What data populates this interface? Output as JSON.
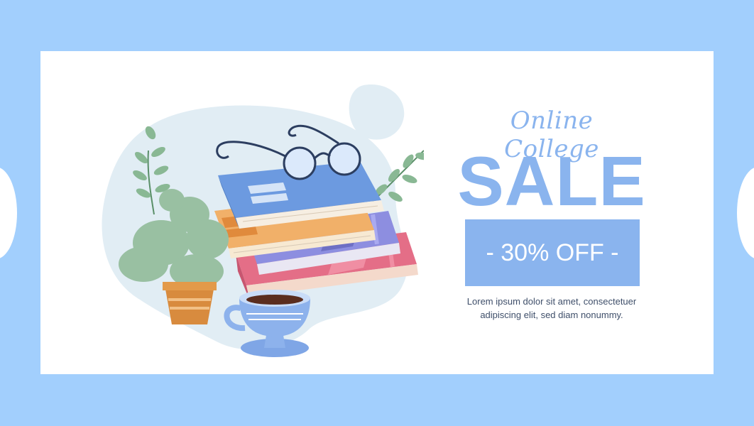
{
  "promo": {
    "script_title": "Online College",
    "headline": "SALE",
    "discount": "- 30% OFF -",
    "description_line1": "Lorem ipsum dolor sit amet, consectetuer",
    "description_line2": "adipiscing elit, sed diam nonummy."
  },
  "colors": {
    "background": "#a2cffd",
    "card": "#ffffff",
    "accent": "#8ab4ee",
    "text": "#3f4f6a"
  },
  "illustration": {
    "elements": [
      "books-stack-icon",
      "eyeglasses-icon",
      "potted-plant-icon",
      "leaf-branch-icon",
      "coffee-cup-icon"
    ]
  }
}
